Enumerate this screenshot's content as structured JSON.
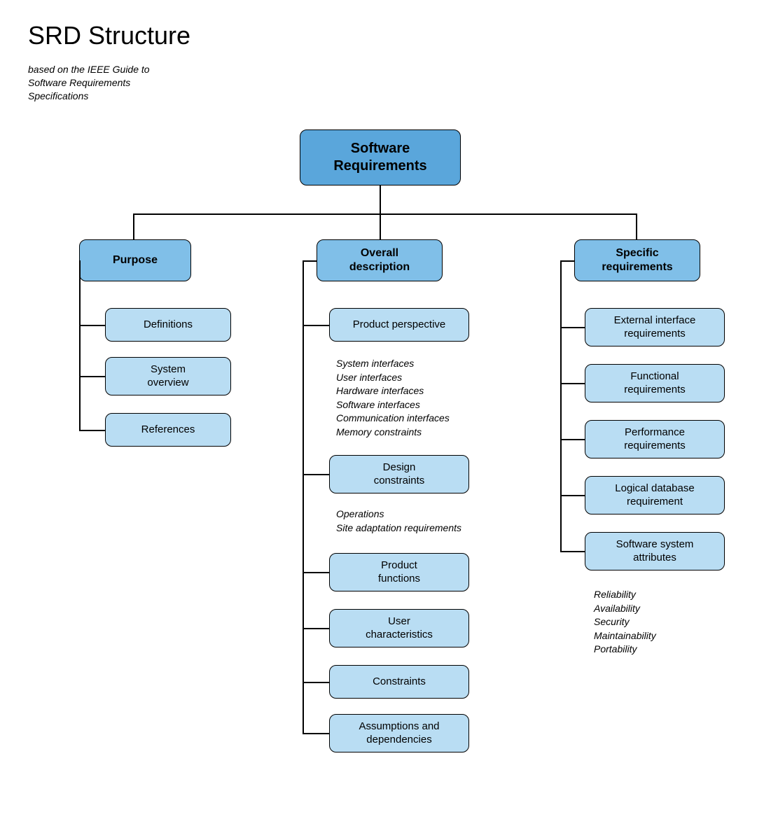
{
  "title": "SRD Structure",
  "subtitle": "based on the IEEE Guide to\nSoftware Requirements\nSpecifications",
  "root": "Software\nRequirements",
  "purpose": {
    "label": "Purpose",
    "children": [
      "Definitions",
      "System\noverview",
      "References"
    ]
  },
  "overall": {
    "label": "Overall\ndescription",
    "children": [
      "Product perspective",
      "Design\nconstraints",
      "Product\nfunctions",
      "User\ncharacteristics",
      "Constraints",
      "Assumptions and\ndependencies"
    ],
    "note1": "System interfaces\nUser interfaces\nHardware interfaces\nSoftware interfaces\nCommunication interfaces\nMemory constraints",
    "note2": "Operations\nSite adaptation requirements"
  },
  "specific": {
    "label": "Specific\nrequirements",
    "children": [
      "External interface\nrequirements",
      "Functional\nrequirements",
      "Performance\nrequirements",
      "Logical database\nrequirement",
      "Software system\nattributes"
    ],
    "note": "Reliability\nAvailability\nSecurity\nMaintainability\nPortability"
  }
}
